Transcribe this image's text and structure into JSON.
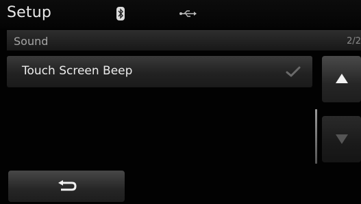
{
  "header": {
    "title": "Setup",
    "bluetooth_icon": "bluetooth-icon",
    "usb_icon": "usb-icon"
  },
  "subheader": {
    "title": "Sound",
    "page_indicator": "2/2"
  },
  "options": [
    {
      "label": "Touch Screen Beep",
      "checked": true,
      "check_icon": "checkmark-icon"
    }
  ],
  "scroll": {
    "up_icon": "triangle-up-icon",
    "down_icon": "triangle-down-icon",
    "down_enabled": false
  },
  "back_button": {
    "icon": "return-arrow-icon"
  },
  "colors": {
    "background": "#020202",
    "text": "#ececec",
    "muted_text": "#a6a6a6",
    "button_top": "#474747",
    "button_bottom": "#1d1d1d"
  }
}
